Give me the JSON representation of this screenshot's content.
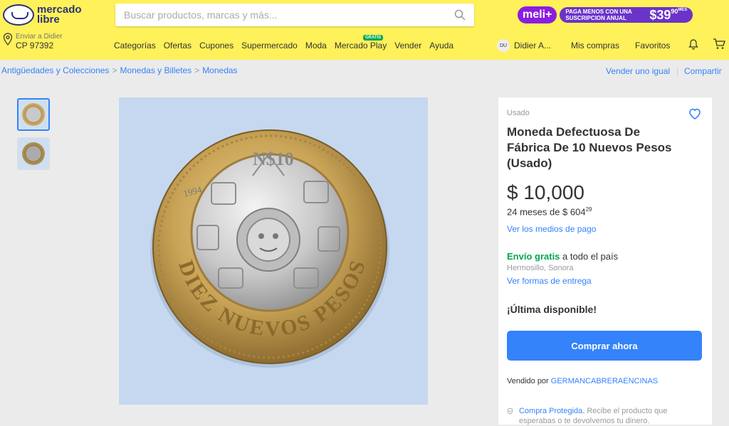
{
  "header": {
    "logo_line1": "mercado",
    "logo_line2": "libre",
    "search_placeholder": "Buscar productos, marcas y más...",
    "promo_badge": "meli+",
    "promo_text": "PAGA MENOS CON UNA SUSCRIPCION ANUAL",
    "promo_price": "$39",
    "promo_cents": "90",
    "promo_period": "MES",
    "ship_line1": "Enviar a Didier",
    "ship_line2": "CP 97392",
    "nav": [
      "Categorías",
      "Ofertas",
      "Cupones",
      "Supermercado",
      "Moda",
      "Mercado Play",
      "Vender",
      "Ayuda"
    ],
    "gratis_badge": "GRATIS",
    "user_initials": "DU",
    "user_name": "Didier A...",
    "my_purchases": "Mis compras",
    "favorites": "Favoritos"
  },
  "breadcrumb": {
    "items": [
      "Antigüedades y Colecciones",
      "Monedas y Billetes",
      "Monedas"
    ],
    "sell_same": "Vender uno igual",
    "share": "Compartir"
  },
  "product": {
    "condition": "Usado",
    "title": "Moneda Defectuosa De Fábrica De 10 Nuevos Pesos (Usado)",
    "price": "$ 10,000",
    "installments": "24 meses de $ 604",
    "installments_cents": "29",
    "payment_link": "Ver los medios de pago",
    "shipping_free": "Envío gratis",
    "shipping_rest": " a todo el país",
    "location": "Hermosillo, Sonora",
    "delivery_link": "Ver formas de entrega",
    "stock": "¡Última disponible!",
    "buy_button": "Comprar ahora",
    "seller_prefix": "Vendido por ",
    "seller_name": "GERMANCABRERAENCINAS",
    "protected_title": "Compra Protegida.",
    "protected_text": " Recibe el producto que esperabas o te devolvemos tu dinero."
  },
  "coin": {
    "text_bottom": "DIEZ NUEVOS PESOS",
    "year": "1994",
    "denomination": "N$10"
  },
  "colors": {
    "header_bg": "#fff159",
    "accent": "#3483fa",
    "green": "#00a650"
  }
}
